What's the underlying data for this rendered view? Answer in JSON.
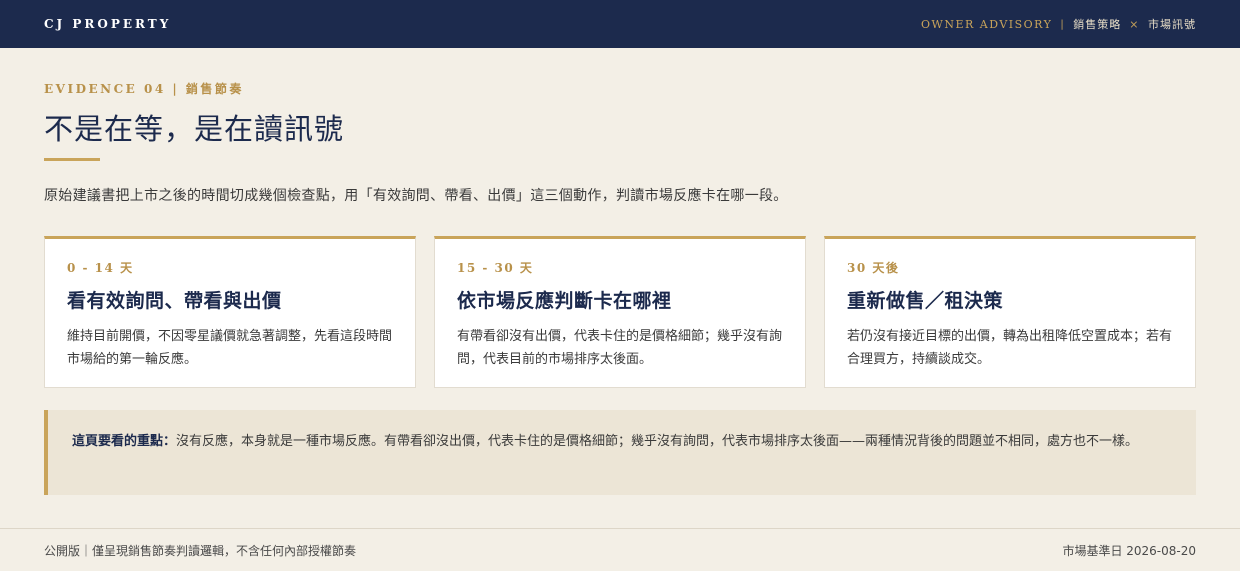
{
  "header": {
    "brand": "CJ PROPERTY",
    "nav_advisory": "OWNER ADVISORY",
    "nav_sep": "|",
    "nav_strategy": "銷售策略",
    "nav_x": "×",
    "nav_signal": "市場訊號"
  },
  "hero": {
    "eyebrow": "EVIDENCE 04 | 銷售節奏",
    "title": "不是在等，是在讀訊號",
    "intro": "原始建議書把上市之後的時間切成幾個檢查點，用「有效詢問、帶看、出價」這三個動作，判讀市場反應卡在哪一段。"
  },
  "cards": [
    {
      "tag": "0 - 14 天",
      "title": "看有效詢問、帶看與出價",
      "body": "維持目前開價，不因零星議價就急著調整，先看這段時間市場給的第一輪反應。"
    },
    {
      "tag": "15 - 30 天",
      "title": "依市場反應判斷卡在哪裡",
      "body": "有帶看卻沒有出價，代表卡住的是價格細節；幾乎沒有詢問，代表目前的市場排序太後面。"
    },
    {
      "tag": "30 天後",
      "title": "重新做售／租決策",
      "body": "若仍沒有接近目標的出價，轉為出租降低空置成本；若有合理買方，持續談成交。"
    }
  ],
  "callout": {
    "lead": "這頁要看的重點：",
    "text": "沒有反應，本身就是一種市場反應。有帶看卻沒出價，代表卡住的是價格細節；幾乎沒有詢問，代表市場排序太後面——兩種情況背後的問題並不相同，處方也不一樣。"
  },
  "footer": {
    "left": "公開版｜僅呈現銷售節奏判讀邏輯，不含任何內部授權節奏",
    "right": "市場基準日 2026-08-20"
  },
  "colors": {
    "navy": "#1c2a4d",
    "gold": "#c9a45a",
    "background": "#f3efe6",
    "callout_bg": "#ece5d6"
  }
}
